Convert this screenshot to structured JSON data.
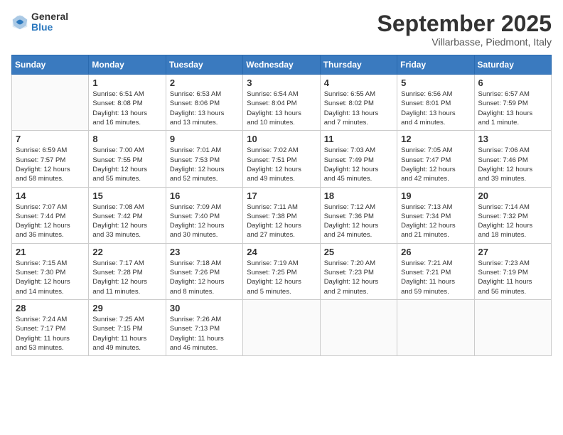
{
  "header": {
    "logo": {
      "line1": "General",
      "line2": "Blue"
    },
    "title": "September 2025",
    "location": "Villarbasse, Piedmont, Italy"
  },
  "calendar": {
    "headers": [
      "Sunday",
      "Monday",
      "Tuesday",
      "Wednesday",
      "Thursday",
      "Friday",
      "Saturday"
    ],
    "weeks": [
      [
        {
          "day": "",
          "info": ""
        },
        {
          "day": "1",
          "info": "Sunrise: 6:51 AM\nSunset: 8:08 PM\nDaylight: 13 hours\nand 16 minutes."
        },
        {
          "day": "2",
          "info": "Sunrise: 6:53 AM\nSunset: 8:06 PM\nDaylight: 13 hours\nand 13 minutes."
        },
        {
          "day": "3",
          "info": "Sunrise: 6:54 AM\nSunset: 8:04 PM\nDaylight: 13 hours\nand 10 minutes."
        },
        {
          "day": "4",
          "info": "Sunrise: 6:55 AM\nSunset: 8:02 PM\nDaylight: 13 hours\nand 7 minutes."
        },
        {
          "day": "5",
          "info": "Sunrise: 6:56 AM\nSunset: 8:01 PM\nDaylight: 13 hours\nand 4 minutes."
        },
        {
          "day": "6",
          "info": "Sunrise: 6:57 AM\nSunset: 7:59 PM\nDaylight: 13 hours\nand 1 minute."
        }
      ],
      [
        {
          "day": "7",
          "info": "Sunrise: 6:59 AM\nSunset: 7:57 PM\nDaylight: 12 hours\nand 58 minutes."
        },
        {
          "day": "8",
          "info": "Sunrise: 7:00 AM\nSunset: 7:55 PM\nDaylight: 12 hours\nand 55 minutes."
        },
        {
          "day": "9",
          "info": "Sunrise: 7:01 AM\nSunset: 7:53 PM\nDaylight: 12 hours\nand 52 minutes."
        },
        {
          "day": "10",
          "info": "Sunrise: 7:02 AM\nSunset: 7:51 PM\nDaylight: 12 hours\nand 49 minutes."
        },
        {
          "day": "11",
          "info": "Sunrise: 7:03 AM\nSunset: 7:49 PM\nDaylight: 12 hours\nand 45 minutes."
        },
        {
          "day": "12",
          "info": "Sunrise: 7:05 AM\nSunset: 7:47 PM\nDaylight: 12 hours\nand 42 minutes."
        },
        {
          "day": "13",
          "info": "Sunrise: 7:06 AM\nSunset: 7:46 PM\nDaylight: 12 hours\nand 39 minutes."
        }
      ],
      [
        {
          "day": "14",
          "info": "Sunrise: 7:07 AM\nSunset: 7:44 PM\nDaylight: 12 hours\nand 36 minutes."
        },
        {
          "day": "15",
          "info": "Sunrise: 7:08 AM\nSunset: 7:42 PM\nDaylight: 12 hours\nand 33 minutes."
        },
        {
          "day": "16",
          "info": "Sunrise: 7:09 AM\nSunset: 7:40 PM\nDaylight: 12 hours\nand 30 minutes."
        },
        {
          "day": "17",
          "info": "Sunrise: 7:11 AM\nSunset: 7:38 PM\nDaylight: 12 hours\nand 27 minutes."
        },
        {
          "day": "18",
          "info": "Sunrise: 7:12 AM\nSunset: 7:36 PM\nDaylight: 12 hours\nand 24 minutes."
        },
        {
          "day": "19",
          "info": "Sunrise: 7:13 AM\nSunset: 7:34 PM\nDaylight: 12 hours\nand 21 minutes."
        },
        {
          "day": "20",
          "info": "Sunrise: 7:14 AM\nSunset: 7:32 PM\nDaylight: 12 hours\nand 18 minutes."
        }
      ],
      [
        {
          "day": "21",
          "info": "Sunrise: 7:15 AM\nSunset: 7:30 PM\nDaylight: 12 hours\nand 14 minutes."
        },
        {
          "day": "22",
          "info": "Sunrise: 7:17 AM\nSunset: 7:28 PM\nDaylight: 12 hours\nand 11 minutes."
        },
        {
          "day": "23",
          "info": "Sunrise: 7:18 AM\nSunset: 7:26 PM\nDaylight: 12 hours\nand 8 minutes."
        },
        {
          "day": "24",
          "info": "Sunrise: 7:19 AM\nSunset: 7:25 PM\nDaylight: 12 hours\nand 5 minutes."
        },
        {
          "day": "25",
          "info": "Sunrise: 7:20 AM\nSunset: 7:23 PM\nDaylight: 12 hours\nand 2 minutes."
        },
        {
          "day": "26",
          "info": "Sunrise: 7:21 AM\nSunset: 7:21 PM\nDaylight: 11 hours\nand 59 minutes."
        },
        {
          "day": "27",
          "info": "Sunrise: 7:23 AM\nSunset: 7:19 PM\nDaylight: 11 hours\nand 56 minutes."
        }
      ],
      [
        {
          "day": "28",
          "info": "Sunrise: 7:24 AM\nSunset: 7:17 PM\nDaylight: 11 hours\nand 53 minutes."
        },
        {
          "day": "29",
          "info": "Sunrise: 7:25 AM\nSunset: 7:15 PM\nDaylight: 11 hours\nand 49 minutes."
        },
        {
          "day": "30",
          "info": "Sunrise: 7:26 AM\nSunset: 7:13 PM\nDaylight: 11 hours\nand 46 minutes."
        },
        {
          "day": "",
          "info": ""
        },
        {
          "day": "",
          "info": ""
        },
        {
          "day": "",
          "info": ""
        },
        {
          "day": "",
          "info": ""
        }
      ]
    ]
  }
}
